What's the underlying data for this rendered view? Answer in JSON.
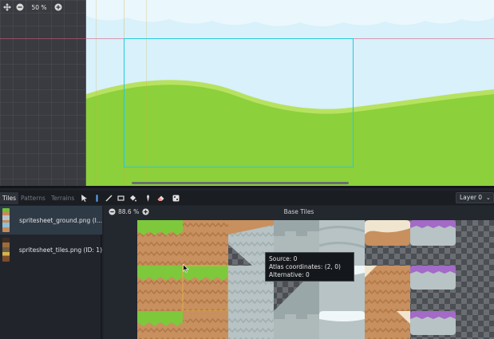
{
  "viewport": {
    "zoom": "50 %",
    "icons": [
      "move-icon",
      "zoom-out-icon",
      "zoom-in-icon"
    ]
  },
  "panel": {
    "tabs": [
      {
        "label": "Tiles",
        "active": true
      },
      {
        "label": "Patterns",
        "active": false
      },
      {
        "label": "Terrains",
        "active": false
      }
    ],
    "tools": [
      "select-icon",
      "paint-icon",
      "line-icon",
      "rect-icon",
      "bucket-icon",
      "picker-icon",
      "eraser-icon",
      "random-icon"
    ],
    "layer": "Layer 0"
  },
  "sources": [
    {
      "label": "spritesheet_ground.png (I...",
      "selected": true
    },
    {
      "label": "spritesheet_tiles.png (ID: 1)",
      "selected": false
    }
  ],
  "atlas": {
    "zoom": "88.6 %",
    "title": "Base Tiles"
  },
  "tooltip": {
    "source": "Source: 0",
    "coords": "Atlas coordinates: (2, 0)",
    "alternative": "Alternative: 0"
  },
  "colors": {
    "sky": "#d8f1fb",
    "grass": "#8cd03c",
    "camera_rect": "#27c8dc",
    "dirt": "#c58a5a",
    "selection": "#2f3a47"
  }
}
